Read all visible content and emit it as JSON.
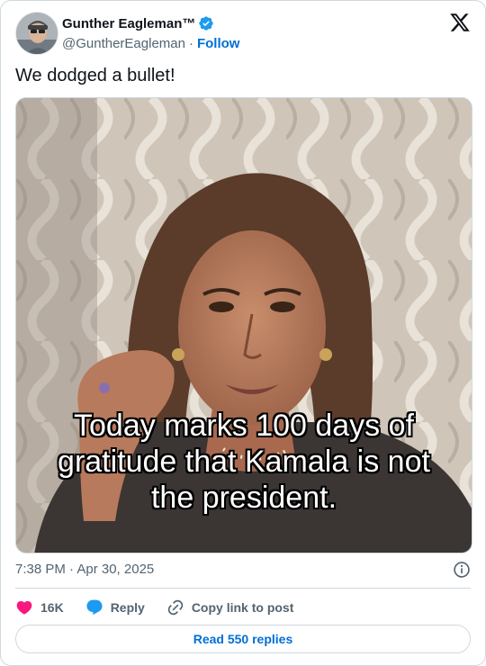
{
  "author": {
    "display_name": "Gunther Eagleman™",
    "handle": "@GuntherEagleman",
    "separator": "·",
    "follow_label": "Follow"
  },
  "tweet": {
    "text": "We dodged a bullet!",
    "image_caption": "Today marks 100 days of gratitude that Kamala is not the president.",
    "timestamp": "7:38 PM · Apr 30, 2025"
  },
  "actions": {
    "like_count": "16K",
    "reply_label": "Reply",
    "copy_link_label": "Copy link to post"
  },
  "read_replies_label": "Read 550 replies",
  "colors": {
    "accent": "#006fd6",
    "like": "#f91880",
    "reply": "#1d9bf0",
    "muted_text": "#536471",
    "border": "#cfd9de",
    "verified": "#1d9bf0"
  }
}
